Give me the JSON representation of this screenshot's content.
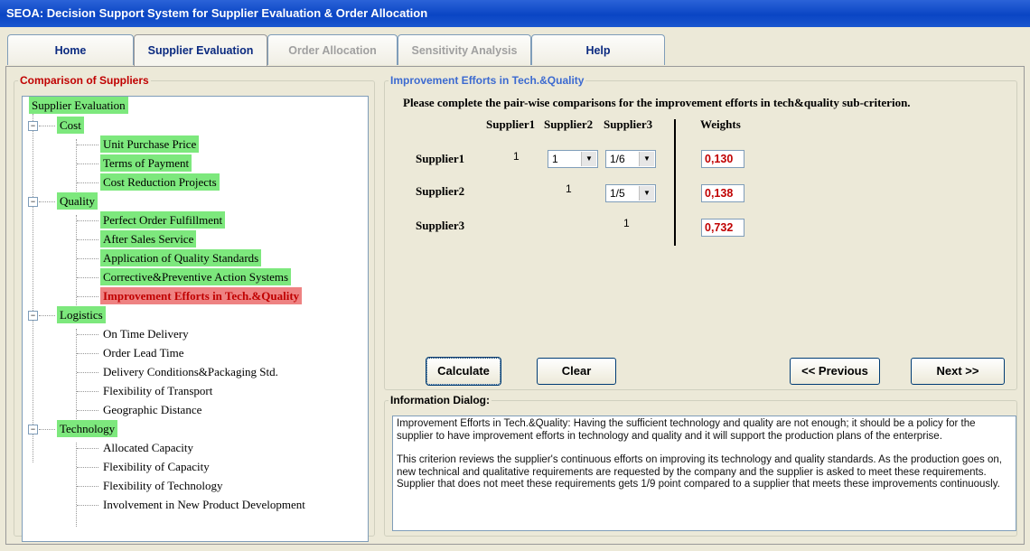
{
  "window": {
    "title": "SEOA: Decision Support System for Supplier Evaluation & Order Allocation"
  },
  "tabs": [
    {
      "label": "Home"
    },
    {
      "label": "Supplier Evaluation"
    },
    {
      "label": "Order Allocation"
    },
    {
      "label": "Sensitivity Analysis"
    },
    {
      "label": "Help"
    }
  ],
  "left": {
    "group_title": "Comparison of Suppliers",
    "root": "Supplier Evaluation",
    "categories": [
      {
        "label": "Cost",
        "items": [
          "Unit Purchase Price",
          "Terms of Payment",
          "Cost Reduction Projects"
        ]
      },
      {
        "label": "Quality",
        "items": [
          "Perfect Order Fulfillment",
          "After Sales Service",
          "Application of Quality Standards",
          "Corrective&Preventive Action Systems",
          "Improvement Efforts in Tech.&Quality"
        ]
      },
      {
        "label": "Logistics",
        "items": [
          "On Time Delivery",
          "Order Lead Time",
          "Delivery Conditions&Packaging Std.",
          "Flexibility of Transport",
          "Geographic Distance"
        ]
      },
      {
        "label": "Technology",
        "items": [
          "Allocated Capacity",
          "Flexibility of Capacity",
          "Flexibility of Technology",
          "Involvement in New Product Development"
        ]
      }
    ]
  },
  "comparison": {
    "group_title": "Improvement Efforts in Tech.&Quality",
    "instruction": "Please complete the pair-wise comparisons for the improvement efforts in tech&quality sub-criterion.",
    "col_headers": [
      "Supplier1",
      "Supplier2",
      "Supplier3"
    ],
    "weights_header": "Weights",
    "rows": [
      {
        "label": "Supplier1",
        "diag": "1",
        "v2": "1",
        "v3": "1/6",
        "weight": "0,130"
      },
      {
        "label": "Supplier2",
        "diag": "1",
        "v3": "1/5",
        "weight": "0,138"
      },
      {
        "label": "Supplier3",
        "diag": "1",
        "weight": "0,732"
      }
    ],
    "buttons": {
      "calculate": "Calculate",
      "clear": "Clear",
      "previous": "<< Previous",
      "next": "Next >>"
    }
  },
  "info": {
    "title": "Information Dialog:",
    "p1": "Improvement Efforts in Tech.&Quality: Having the sufficient technology and quality are not enough; it should be a policy for the supplier to have improvement efforts in technology and quality and it will support the production plans of the enterprise.",
    "p2": "This criterion reviews the supplier's continuous efforts on improving its technology and quality standards. As the production goes on, new technical and qualitative requirements are requested by the company and the supplier is asked to meet these requirements. Supplier that does not meet these requirements gets 1/9 point compared to a supplier that meets these improvements continuously."
  },
  "colors": {
    "tree_highlight": "#7de87d",
    "selected": "#ee8282",
    "accent_red": "#c00000",
    "title_blue": "#0a45c4"
  }
}
